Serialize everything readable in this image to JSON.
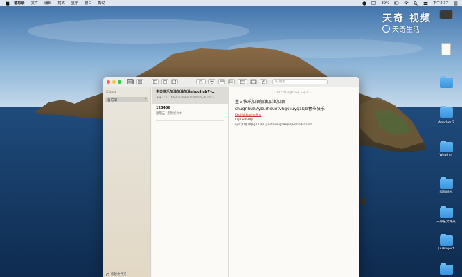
{
  "menubar": {
    "app_name": "备忘录",
    "menus": [
      "文件",
      "编辑",
      "格式",
      "显示",
      "窗口",
      "帮助"
    ],
    "battery": "39%",
    "clock": "下午2:37"
  },
  "watermark": {
    "line1": "天奇 视频",
    "line2": "天奇生活"
  },
  "sidebar": {
    "section_header": "iCloud",
    "folder_name": "备忘录",
    "folder_count": "2",
    "footer_label": "新建文件夹"
  },
  "toolbar": {
    "aa_label": "Aa",
    "search_placeholder": "搜索"
  },
  "notes": [
    {
      "title": "生日快乐加油加油加油shughuh7y...",
      "time": "下午2:37",
      "preview": "Kkghitkkuoihkj9hk KLJB H#..."
    },
    {
      "title": "123456",
      "time": "星期五",
      "preview": "无附加文本"
    }
  ],
  "editor": {
    "date": "2022年3月15日 下午2:37",
    "line1": "生日快乐加油加油加油加油",
    "line2_text": "shugnhuh7ybuihquotvhgkjiuyg1kjb",
    "line2_suffix": "春节快乐",
    "small1": "Kkghitkkuoihkj9hk",
    "small2": "KLJB H#H#JU",
    "small3": "njkk;KDJ;LKJHJ;DLJHL;jkerk9eeuJDBHJvsJHsjhh9clkuojh"
  },
  "desktop_icons": [
    {
      "label": "",
      "kind": "drive"
    },
    {
      "label": "",
      "kind": "doc"
    },
    {
      "label": "",
      "kind": "folder"
    },
    {
      "label": "",
      "kind": "folder"
    },
    {
      "label": "Weather 2",
      "kind": "folder"
    },
    {
      "label": "Weather",
      "kind": "folder"
    },
    {
      "label": "samples",
      "kind": "folder"
    },
    {
      "label": "未命名文件夹",
      "kind": "folder"
    },
    {
      "label": "J22Project",
      "kind": "folder"
    },
    {
      "label": "",
      "kind": "folder"
    }
  ]
}
